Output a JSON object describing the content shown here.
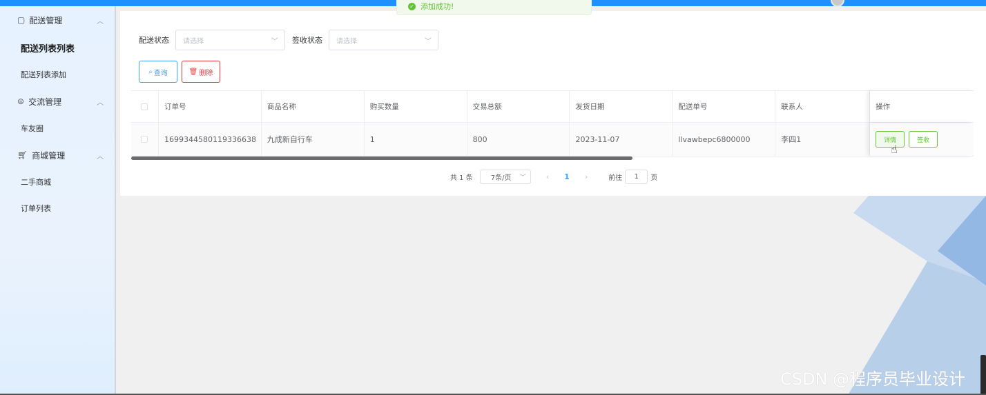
{
  "toast": {
    "message": "添加成功!"
  },
  "sidebar": {
    "groups": [
      {
        "label": "配送管理",
        "icon": "clipboard-icon",
        "items": [
          {
            "label": "配送列表列表",
            "active": true
          },
          {
            "label": "配送列表添加",
            "active": false
          }
        ]
      },
      {
        "label": "交流管理",
        "icon": "chat-icon",
        "items": [
          {
            "label": "车友圈",
            "active": false
          }
        ]
      },
      {
        "label": "商城管理",
        "icon": "cart-icon",
        "items": [
          {
            "label": "二手商城",
            "active": false
          },
          {
            "label": "订单列表",
            "active": false
          }
        ]
      }
    ]
  },
  "filters": {
    "delivery_status_label": "配送状态",
    "delivery_status_placeholder": "请选择",
    "sign_status_label": "签收状态",
    "sign_status_placeholder": "请选择"
  },
  "actions": {
    "query_label": "查询",
    "delete_label": "删除"
  },
  "table": {
    "columns": [
      "订单号",
      "商品名称",
      "购买数量",
      "交易总额",
      "发货日期",
      "配送单号",
      "联系人",
      "操作"
    ],
    "rows": [
      {
        "order_no": "1699344580119336638",
        "product": "九成新自行车",
        "quantity": "1",
        "total": "800",
        "ship_date": "2023-11-07",
        "delivery_no": "llvawbepc6800000",
        "contact": "李四1",
        "detail_label": "详情",
        "sign_label": "签收"
      }
    ]
  },
  "pagination": {
    "total_text": "共 1 条",
    "page_size": "7条/页",
    "current_page": "1",
    "goto_label": "前往",
    "goto_value": "1",
    "page_suffix": "页"
  },
  "watermark": "CSDN @程序员毕业设计",
  "colors": {
    "primary": "#409eff",
    "success": "#67c23a",
    "danger": "#e4393c",
    "topbar": "#1e90ff"
  }
}
